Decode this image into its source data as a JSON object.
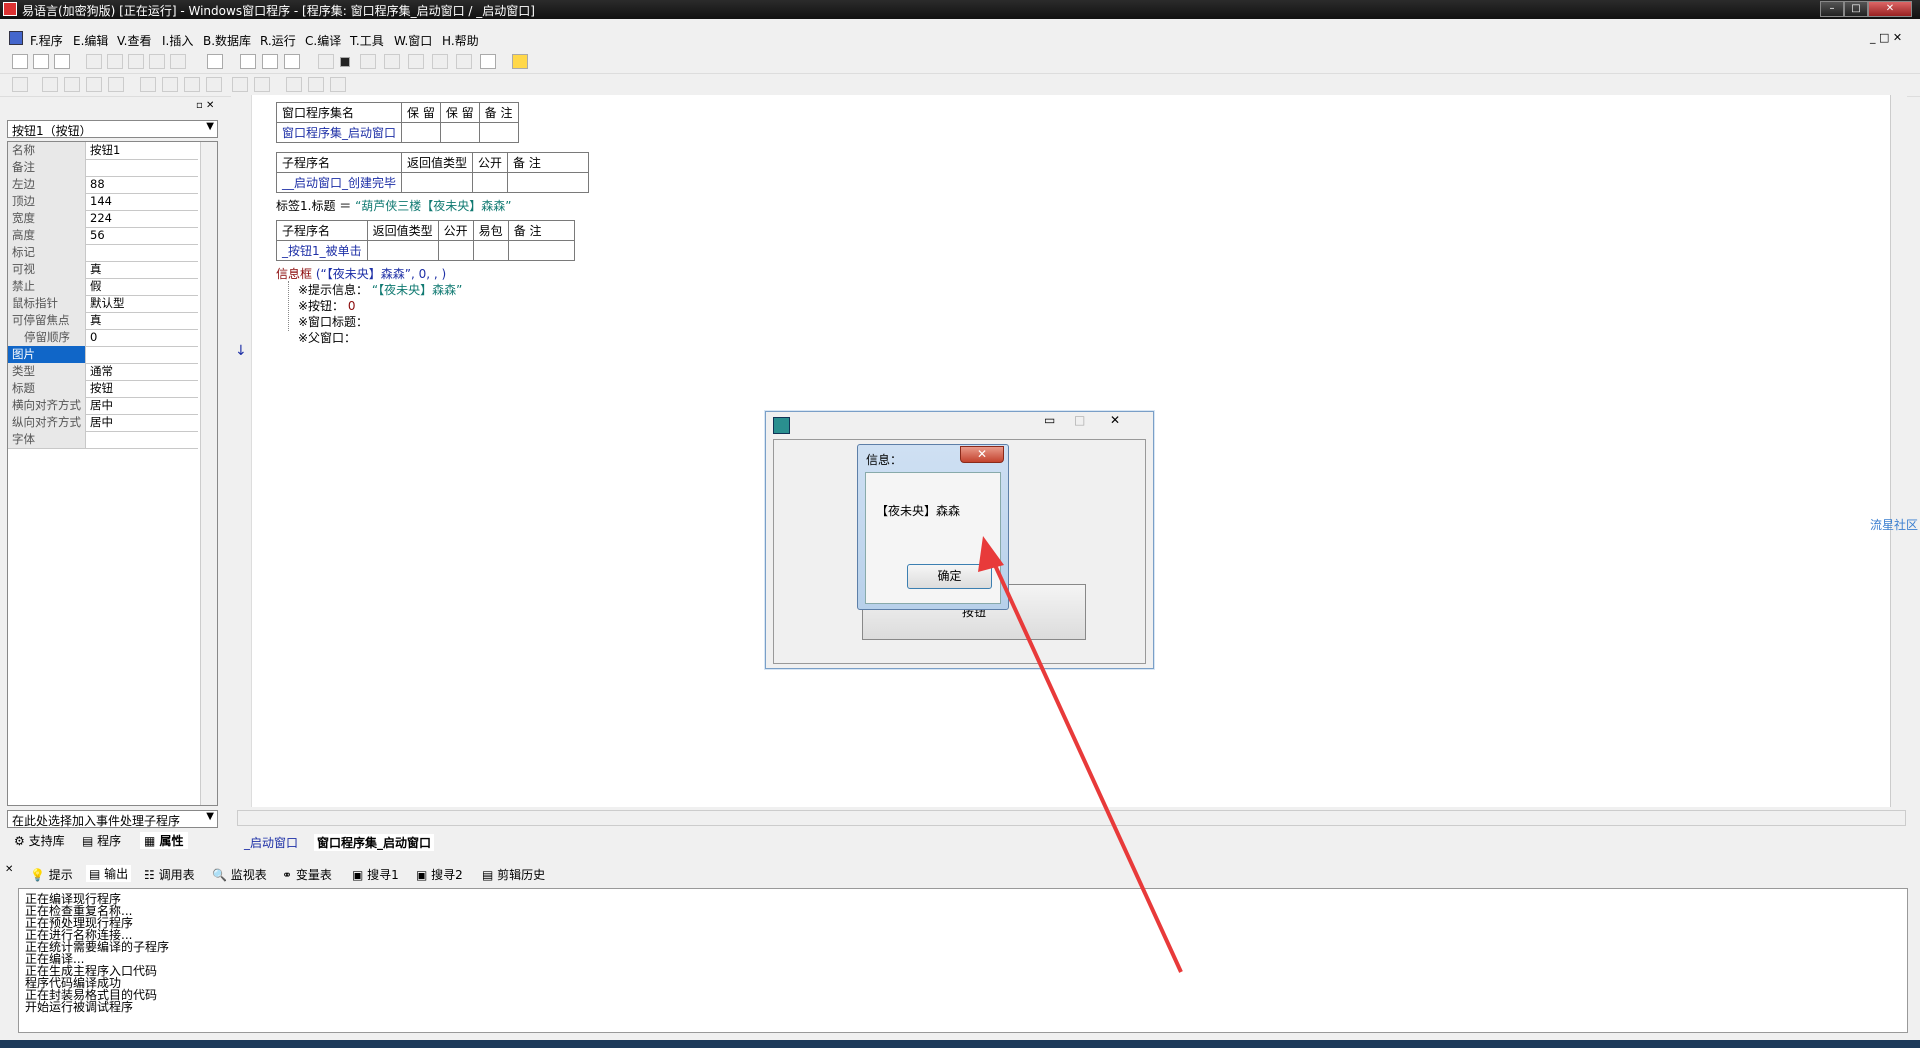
{
  "window": {
    "title": "易语言(加密狗版) [正在运行] - Windows窗口程序 - [程序集: 窗口程序集_启动窗口 / _启动窗口]"
  },
  "menu": [
    "F.程序",
    "E.编辑",
    "V.查看",
    "I.插入",
    "B.数据库",
    "R.运行",
    "C.编译",
    "T.工具",
    "W.窗口",
    "H.帮助"
  ],
  "left_panel": {
    "component_select": "按钮1（按钮）",
    "properties": [
      {
        "name": "名称",
        "value": "按钮1"
      },
      {
        "name": "备注",
        "value": ""
      },
      {
        "name": "左边",
        "value": "88"
      },
      {
        "name": "顶边",
        "value": "144"
      },
      {
        "name": "宽度",
        "value": "224"
      },
      {
        "name": "高度",
        "value": "56"
      },
      {
        "name": "标记",
        "value": ""
      },
      {
        "name": "可视",
        "value": "真"
      },
      {
        "name": "禁止",
        "value": "假"
      },
      {
        "name": "鼠标指针",
        "value": "默认型"
      },
      {
        "name": "可停留焦点",
        "value": "真"
      },
      {
        "name": "停留顺序",
        "value": "0"
      },
      {
        "name": "图片",
        "value": ""
      },
      {
        "name": "类型",
        "value": "通常"
      },
      {
        "name": "标题",
        "value": "按钮"
      },
      {
        "name": "横向对齐方式",
        "value": "居中"
      },
      {
        "name": "纵向对齐方式",
        "value": "居中"
      },
      {
        "name": "字体",
        "value": ""
      }
    ],
    "event_select": "在此处选择加入事件处理子程序",
    "tabs": [
      "支持库",
      "程序",
      "属性"
    ]
  },
  "code": {
    "assembly_header": [
      "窗口程序集名",
      "保 留",
      "保 留",
      "备 注"
    ],
    "assembly_name": "窗口程序集_启动窗口",
    "sub_header1": [
      "子程序名",
      "返回值类型",
      "公开",
      "备 注"
    ],
    "sub1_name": "__启动窗口_创建完毕",
    "line1_left": "标签1.标题 ＝ ",
    "line1_right": "“葫芦侠三楼【夜未央】森森”",
    "sub_header2": [
      "子程序名",
      "返回值类型",
      "公开",
      "易包",
      "备 注"
    ],
    "sub2_name": "_按钮1_被单击",
    "msg_call": "信息框",
    "msg_args": " (“【夜未央】森森”, 0, , )",
    "param1_label": "※提示信息：",
    "param1_value": "“【夜未央】森森”",
    "param2_label": "※按钮：",
    "param2_value": "0",
    "param3_label": "※窗口标题：",
    "param4_label": "※父窗口："
  },
  "doc_tabs": [
    "_启动窗口",
    "窗口程序集_启动窗口"
  ],
  "output_tabs": [
    "提示",
    "输出",
    "调用表",
    "监视表",
    "变量表",
    "搜寻1",
    "搜寻2",
    "剪辑历史"
  ],
  "output_lines": [
    "正在编译现行程序",
    "正在检查重复名称...",
    "正在预处理现行程序",
    "正在进行名称连接...",
    "正在统计需要编译的子程序",
    "正在编译...",
    "正在生成主程序入口代码",
    "程序代码编译成功",
    "正在封装易格式目的代码",
    "开始运行被调试程序"
  ],
  "running_form": {
    "button_label": "按钮"
  },
  "message_box": {
    "title": "信息：",
    "text": "【夜未央】森森",
    "ok": "确定",
    "close": "✕"
  },
  "side_link": "流星社区",
  "colors": {
    "arrow": "#e83a3a",
    "selection": "#1066c8"
  }
}
